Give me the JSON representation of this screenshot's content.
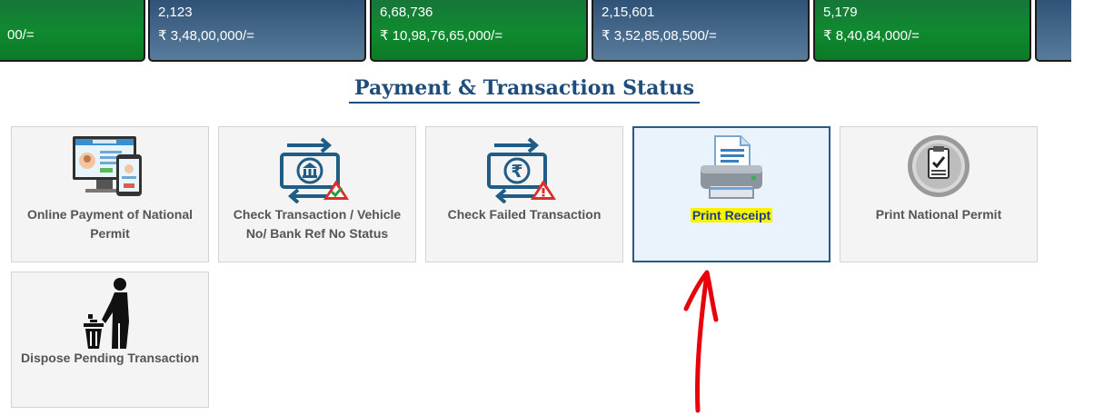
{
  "stats": [
    {
      "count": "",
      "amount": "00/=",
      "theme": "green"
    },
    {
      "count": "2,123",
      "amount": "₹ 3,48,00,000/=",
      "theme": "blue"
    },
    {
      "count": "6,68,736",
      "amount": "₹ 10,98,76,65,000/=",
      "theme": "green"
    },
    {
      "count": "2,15,601",
      "amount": "₹ 3,52,85,08,500/=",
      "theme": "blue"
    },
    {
      "count": "5,179",
      "amount": "₹ 8,40,84,000/=",
      "theme": "green"
    }
  ],
  "section": {
    "title": "Payment & Transaction Status"
  },
  "tiles": [
    {
      "label": "Online Payment of National Permit",
      "icon": "online-payment-icon"
    },
    {
      "label": "Check Transaction / Vehicle No/ Bank Ref No Status",
      "icon": "bank-transaction-status-icon"
    },
    {
      "label": "Check Failed Transaction",
      "icon": "failed-transaction-icon"
    },
    {
      "label": "Print Receipt",
      "icon": "printer-icon"
    },
    {
      "label": "Print National Permit",
      "icon": "permit-seal-icon"
    },
    {
      "label": "Dispose Pending Transaction",
      "icon": "dispose-trash-icon"
    }
  ],
  "colors": {
    "accent": "#1f4d7b",
    "green_card": "#0f8a2f",
    "blue_card": "#46698b",
    "highlight": "#f6f400",
    "annotation": "#e8000b"
  }
}
